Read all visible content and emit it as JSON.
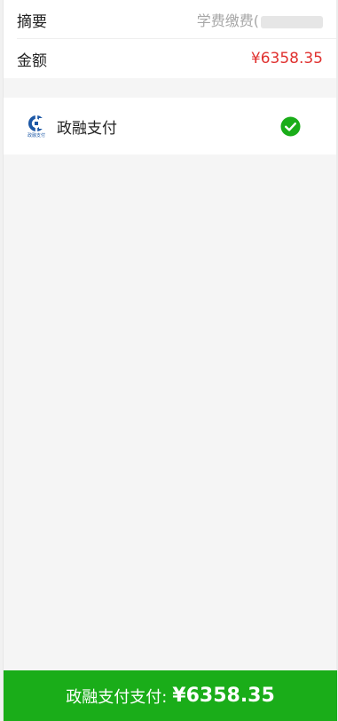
{
  "order": {
    "summary_label": "摘要",
    "summary_value": "学费缴费(",
    "summary_tail": "",
    "amount_label": "金额",
    "amount_value": "¥6358.35"
  },
  "payment_method": {
    "name": "政融支付",
    "logo_caption": "政融支付",
    "icon": "zhengrong-pay-logo-icon",
    "selected": true,
    "check_icon": "check-circle-icon"
  },
  "pay_button": {
    "label": "政融支付支付:",
    "amount": "¥6358.35"
  },
  "colors": {
    "brand_green": "#1aad19",
    "amount_red": "#e0312f",
    "logo_blue": "#1c57a5"
  }
}
